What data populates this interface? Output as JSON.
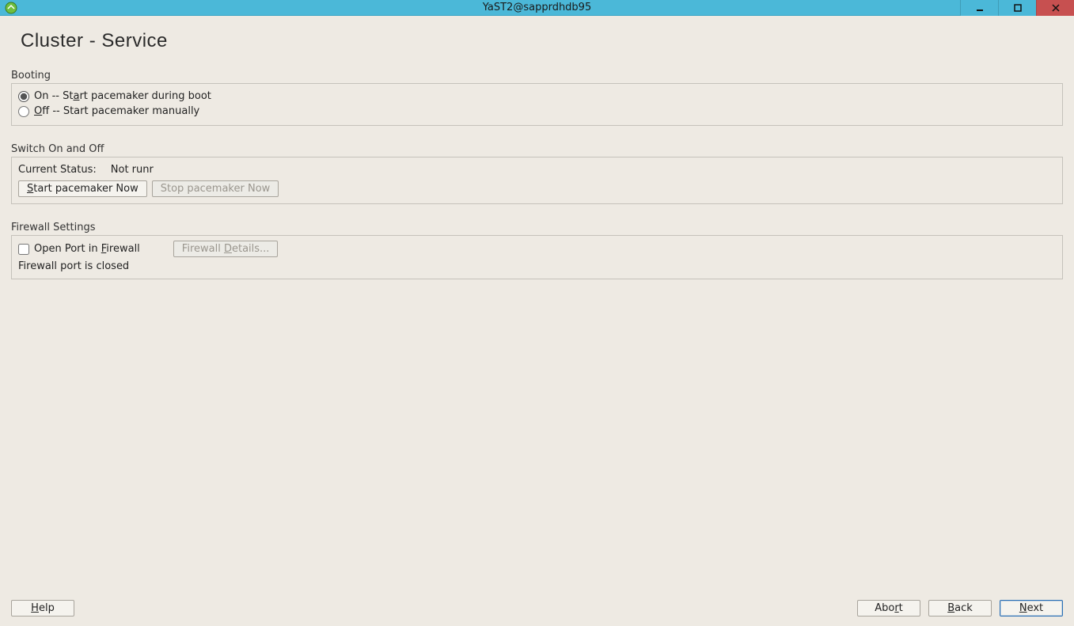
{
  "window": {
    "title": "YaST2@sapprdhdb95"
  },
  "page_title": "Cluster - Service",
  "booting": {
    "label": "Booting",
    "on_prefix": "On -- St",
    "on_mnemonic": "a",
    "on_suffix": "rt pacemaker during boot",
    "off_mnemonic": "O",
    "off_suffix": "ff -- Start pacemaker manually"
  },
  "switch": {
    "label": "Switch On and Off",
    "status_label": "Current Status: ",
    "status_value": "Not runr",
    "start_mnemonic": "S",
    "start_suffix": "tart pacemaker Now",
    "stop_label": "Stop pacemaker Now"
  },
  "firewall": {
    "label": "Firewall Settings",
    "open_prefix": "Open Port in ",
    "open_mnemonic": "F",
    "open_suffix": "irewall",
    "details_prefix": "Firewall ",
    "details_mnemonic": "D",
    "details_suffix": "etails...",
    "status": "Firewall port is closed"
  },
  "footer": {
    "help_mnemonic": "H",
    "help_suffix": "elp",
    "abort_prefix": "Abo",
    "abort_mnemonic": "r",
    "abort_suffix": "t",
    "back_mnemonic": "B",
    "back_suffix": "ack",
    "next_mnemonic": "N",
    "next_suffix": "ext"
  }
}
